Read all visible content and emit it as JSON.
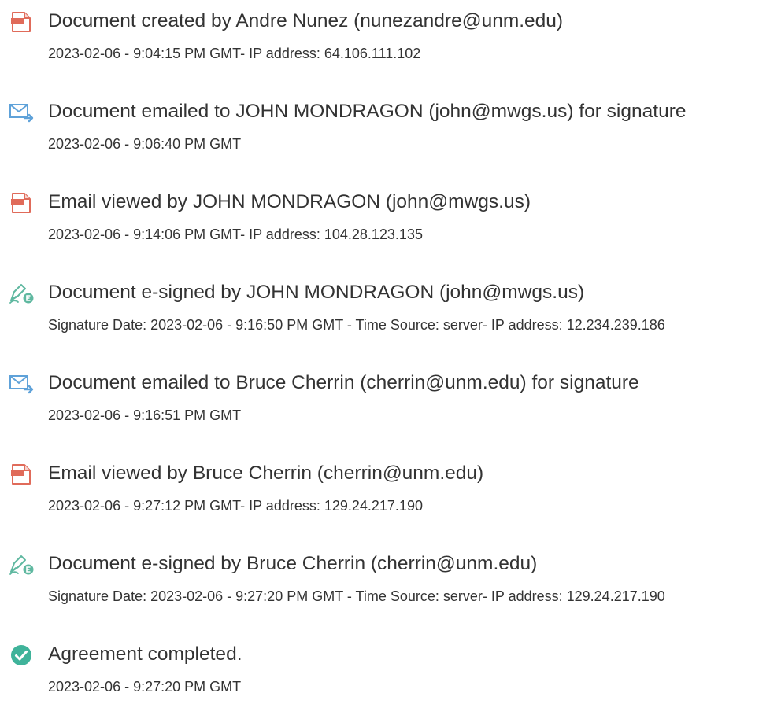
{
  "audit_log": {
    "events": [
      {
        "icon": "document-created-icon",
        "title": "Document created by Andre Nunez (nunezandre@unm.edu)",
        "detail": "2023-02-06 - 9:04:15 PM GMT- IP address: 64.106.111.102"
      },
      {
        "icon": "email-sent-icon",
        "title": "Document emailed to JOHN MONDRAGON (john@mwgs.us) for signature",
        "detail": "2023-02-06 - 9:06:40 PM GMT"
      },
      {
        "icon": "document-viewed-icon",
        "title": "Email viewed by JOHN MONDRAGON (john@mwgs.us)",
        "detail": "2023-02-06 - 9:14:06 PM GMT- IP address: 104.28.123.135"
      },
      {
        "icon": "e-sign-icon",
        "title": "Document e-signed by JOHN MONDRAGON (john@mwgs.us)",
        "detail": "Signature Date: 2023-02-06 - 9:16:50 PM GMT - Time Source: server- IP address: 12.234.239.186"
      },
      {
        "icon": "email-sent-icon",
        "title": "Document emailed to Bruce Cherrin (cherrin@unm.edu) for signature",
        "detail": "2023-02-06 - 9:16:51 PM GMT"
      },
      {
        "icon": "document-viewed-icon",
        "title": "Email viewed by Bruce Cherrin (cherrin@unm.edu)",
        "detail": "2023-02-06 - 9:27:12 PM GMT- IP address: 129.24.217.190"
      },
      {
        "icon": "e-sign-icon",
        "title": "Document e-signed by Bruce Cherrin (cherrin@unm.edu)",
        "detail": "Signature Date: 2023-02-06 - 9:27:20 PM GMT - Time Source: server- IP address: 129.24.217.190"
      },
      {
        "icon": "check-circle-icon",
        "title": "Agreement completed.",
        "detail": "2023-02-06 - 9:27:20 PM GMT"
      }
    ]
  },
  "colors": {
    "text": "#333333",
    "document_icon": "#e06b5a",
    "email_icon": "#5fa2d9",
    "sign_icon": "#5fb8a0",
    "check_icon": "#3fb39a"
  }
}
